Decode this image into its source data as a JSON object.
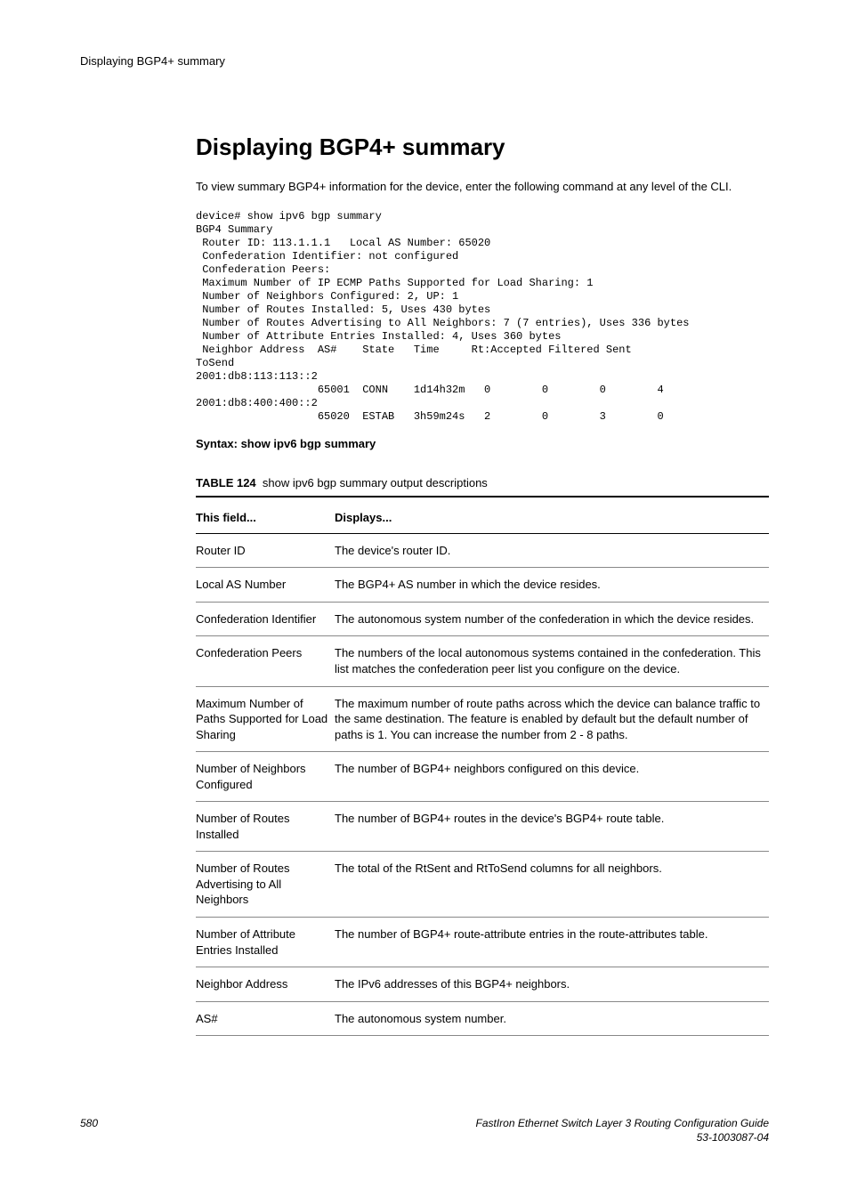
{
  "running_head": "Displaying BGP4+ summary",
  "title": "Displaying BGP4+ summary",
  "intro": "To view summary BGP4+ information for the device, enter the following command at any level of the CLI.",
  "cli_output": "device# show ipv6 bgp summary\nBGP4 Summary\n Router ID: 113.1.1.1   Local AS Number: 65020\n Confederation Identifier: not configured\n Confederation Peers:\n Maximum Number of IP ECMP Paths Supported for Load Sharing: 1\n Number of Neighbors Configured: 2, UP: 1\n Number of Routes Installed: 5, Uses 430 bytes\n Number of Routes Advertising to All Neighbors: 7 (7 entries), Uses 336 bytes\n Number of Attribute Entries Installed: 4, Uses 360 bytes\n Neighbor Address  AS#    State   Time     Rt:Accepted Filtered Sent  \nToSend\n2001:db8:113:113::2\n                   65001  CONN    1d14h32m   0        0        0        4\n2001:db8:400:400::2\n                   65020  ESTAB   3h59m24s   2        0        3        0",
  "syntax": "Syntax: show ipv6 bgp summary",
  "table": {
    "number": "TABLE 124",
    "caption": "show ipv6 bgp summary output descriptions",
    "headers": {
      "col1": "This field...",
      "col2": "Displays..."
    },
    "rows": [
      {
        "field": "Router ID",
        "desc": "The device's router ID."
      },
      {
        "field": "Local AS Number",
        "desc": "The BGP4+ AS number in which the device resides."
      },
      {
        "field": "Confederation Identifier",
        "desc": "The autonomous system number of the confederation in which the device resides."
      },
      {
        "field": "Confederation Peers",
        "desc": "The numbers of the local autonomous systems contained in the confederation. This list matches the confederation peer list you configure on the device."
      },
      {
        "field": "Maximum Number of Paths Supported for Load Sharing",
        "desc": "The maximum number of route paths across which the device can balance traffic to the same destination. The feature is enabled by default but the default number of paths is 1. You can increase the number from 2 - 8 paths."
      },
      {
        "field": "Number of Neighbors Configured",
        "desc": "The number of BGP4+ neighbors configured on this device."
      },
      {
        "field": "Number of Routes Installed",
        "desc": "The number of BGP4+ routes in the device's BGP4+ route table."
      },
      {
        "field": "Number of Routes Advertising to All Neighbors",
        "desc": "The total of the RtSent and RtToSend columns for all neighbors."
      },
      {
        "field": "Number of Attribute Entries Installed",
        "desc": "The number of BGP4+ route-attribute entries in the route-attributes table."
      },
      {
        "field": "Neighbor Address",
        "desc": "The IPv6 addresses of this BGP4+ neighbors."
      },
      {
        "field": "AS#",
        "desc": "The autonomous system number."
      }
    ]
  },
  "footer": {
    "page": "580",
    "doc_title": "FastIron Ethernet Switch Layer 3 Routing Configuration Guide",
    "doc_number": "53-1003087-04"
  }
}
